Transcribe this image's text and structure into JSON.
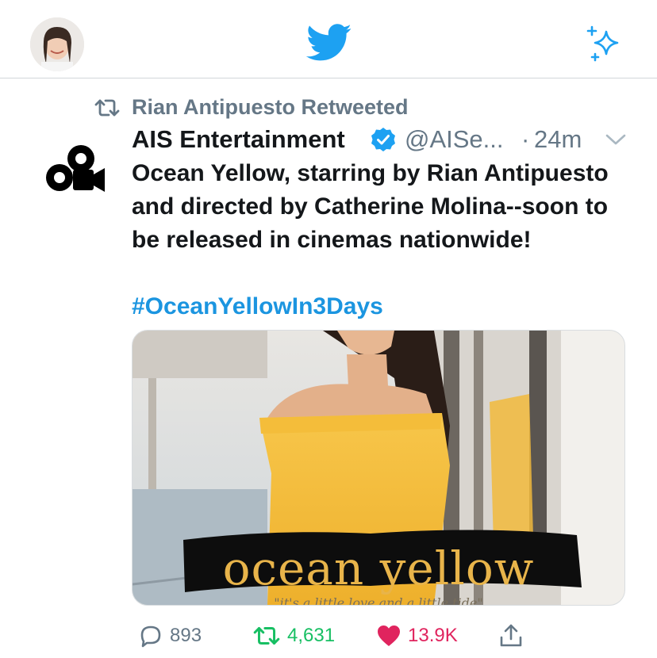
{
  "topbar": {
    "avatar_icon": "profile-avatar",
    "logo_icon": "twitter-bird-icon",
    "sparkle_icon": "sparkle-icon",
    "brand_color": "#1da1f2"
  },
  "tweet": {
    "retweet_context": "Rian Antipuesto Retweeted",
    "account_name": "AIS Entertainment",
    "handle": "@AISe...",
    "separator": "·",
    "time_ago": "24m",
    "text": "Ocean Yellow, starring by Rian Antipuesto and directed by Catherine Molina--soon to be released in cinemas nationwide!",
    "hashtag": "#OceanYellowIn3Days",
    "media": {
      "title": "ocean yellow",
      "subtitle": "\"it's a little love and a little tide\""
    },
    "actions": {
      "replies": "893",
      "retweets": "4,631",
      "likes": "13.9K"
    },
    "colors": {
      "secondary_text": "#657786",
      "hashtag": "#1b95e0",
      "retweet_green": "#17bf63",
      "like_red": "#e0245e",
      "verified_blue": "#1da1f2"
    }
  }
}
